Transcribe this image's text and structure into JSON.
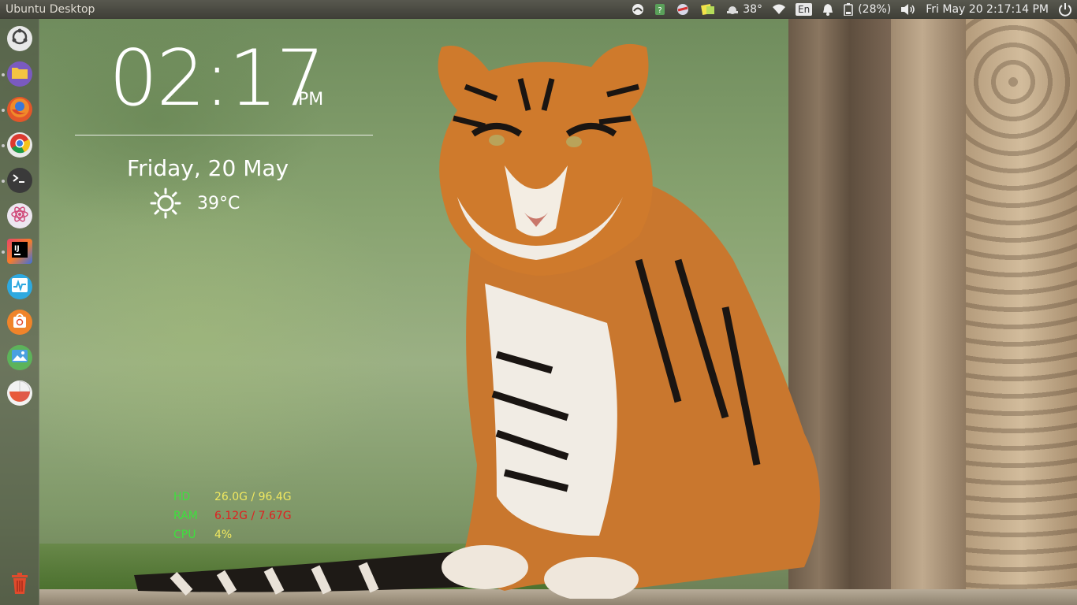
{
  "panel": {
    "title": "Ubuntu Desktop",
    "weather_temp": "38°",
    "language": "En",
    "battery": "(28%)",
    "datetime": "Fri May 20  2:17:14 PM"
  },
  "launcher": {
    "items": [
      {
        "name": "ubuntu-dash",
        "color": "#dddddd"
      },
      {
        "name": "files",
        "color": "#e8c34a"
      },
      {
        "name": "firefox",
        "color": "#e86a2c"
      },
      {
        "name": "chrome",
        "color": "#4caf50"
      },
      {
        "name": "terminal",
        "color": "#3c3c3c"
      },
      {
        "name": "atom",
        "color": "#e9e1ef"
      },
      {
        "name": "intellij",
        "color": "#e14e74"
      },
      {
        "name": "system-monitor",
        "color": "#29a9df"
      },
      {
        "name": "ubuntu-software",
        "color": "#e57c28"
      },
      {
        "name": "shotwell",
        "color": "#58b35a"
      },
      {
        "name": "disk-usage",
        "color": "#eeeeee"
      }
    ],
    "trash_color": "#e04a2c"
  },
  "clock": {
    "time": "02:17",
    "ampm": "PM",
    "date": "Friday, 20 May",
    "temperature": "39°C"
  },
  "sysmon": {
    "hd_label": "HD",
    "hd_value": "26.0G / 96.4G",
    "ram_label": "RAM",
    "ram_value": "6.12G / 7.67G",
    "cpu_label": "CPU",
    "cpu_value": "4%"
  }
}
